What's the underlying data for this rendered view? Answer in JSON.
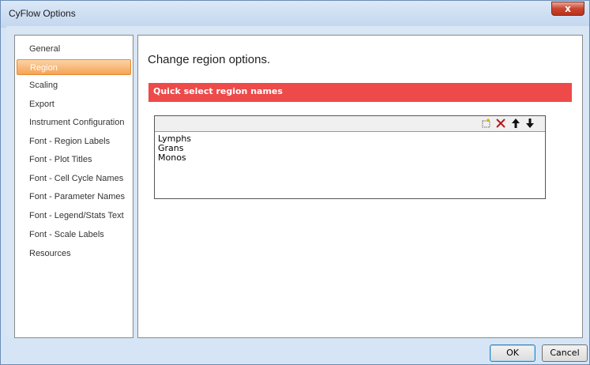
{
  "window": {
    "title": "CyFlow Options",
    "close_label": "x"
  },
  "sidebar": {
    "items": [
      {
        "label": "General",
        "active": false
      },
      {
        "label": "Region",
        "active": true
      },
      {
        "label": "Scaling",
        "active": false
      },
      {
        "label": "Export",
        "active": false
      },
      {
        "label": "Instrument Configuration",
        "active": false
      },
      {
        "label": "Font - Region Labels",
        "active": false
      },
      {
        "label": "Font - Plot Titles",
        "active": false
      },
      {
        "label": "Font - Cell Cycle Names",
        "active": false
      },
      {
        "label": "Font - Parameter Names",
        "active": false
      },
      {
        "label": "Font - Legend/Stats Text",
        "active": false
      },
      {
        "label": "Font - Scale Labels",
        "active": false
      },
      {
        "label": "Resources",
        "active": false
      }
    ]
  },
  "main": {
    "heading": "Change region options.",
    "section_title": "Quick select region names",
    "toolbar": {
      "icons": [
        "new-item-icon",
        "delete-icon",
        "move-up-icon",
        "move-down-icon"
      ]
    },
    "region_names": [
      "Lymphs",
      "Grans",
      "Monos"
    ]
  },
  "buttons": {
    "ok": "OK",
    "cancel": "Cancel"
  },
  "colors": {
    "banner": "#ee4a4a",
    "active_item": "#f6a355"
  }
}
